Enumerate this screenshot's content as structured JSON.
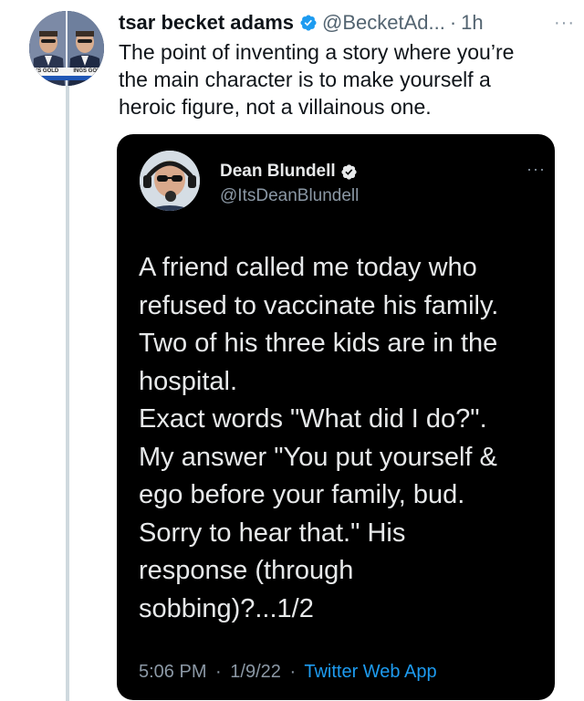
{
  "tweet": {
    "author_name": "tsar becket adams",
    "handle": "@BecketAd...",
    "separator": "·",
    "time": "1h",
    "more_label": "···",
    "text_lines": [
      "The point of inventing a story where you’re",
      "the main character is to make yourself a",
      "heroic figure, not a villainous one."
    ],
    "avatar_caption_left": "'S GOLD",
    "avatar_caption_right": "INGS GOI"
  },
  "quoted": {
    "author_name": "Dean Blundell",
    "handle": "@ItsDeanBlundell",
    "more_label": "···",
    "text_lines": [
      "A friend called me today who",
      "refused to vaccinate his family.",
      "Two of his three kids are in the",
      "hospital.",
      "Exact words \"What did I do?\".",
      "My answer \"You put yourself &",
      "ego before your family, bud.",
      "Sorry to hear that.\" His",
      "response (through",
      "sobbing)?...1/2"
    ],
    "time": "5:06 PM",
    "separator": "·",
    "date": "1/9/22",
    "source": "Twitter Web App"
  },
  "colors": {
    "verified": "#1d9bf0",
    "link": "#1d9bf0",
    "card_bg": "#000000",
    "thread_line": "#cfd9de"
  },
  "icons": {
    "verified": "verified-badge-icon",
    "more": "more-horizontal-icon"
  }
}
